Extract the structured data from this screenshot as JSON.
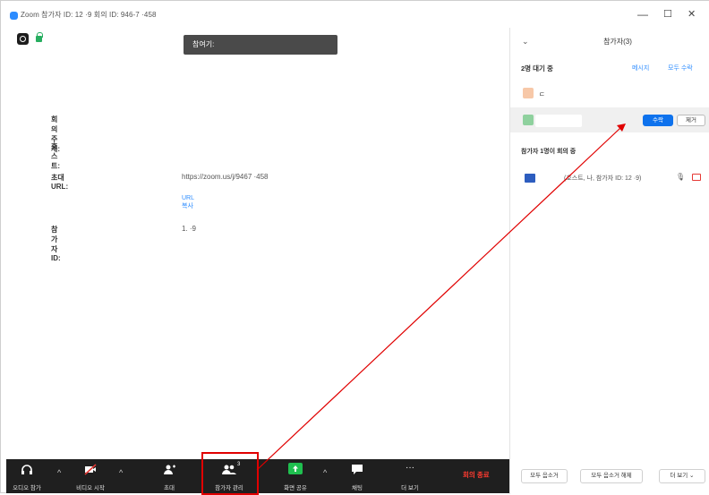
{
  "window": {
    "title": "Zoom 참가자 ID: 12 ·9 회의 ID: 946-7 ·458",
    "controls": {
      "minimize": "—",
      "maximize": "☐",
      "close": "✕"
    }
  },
  "main": {
    "tooltip": "참여기:",
    "info": {
      "topic_label": "회의 주제:",
      "host_label": "호스트:",
      "invite_url_label": "초대 URL:",
      "invite_url_value": "https://zoom.us/j/9467 ·458",
      "copy_url_link": "URL 복사",
      "participant_id_label": "참가자 ID:",
      "participant_id_value": "1. ·9"
    }
  },
  "toolbar": {
    "audio_label": "오디오 참가",
    "video_label": "비디오 시작",
    "invite_label": "초대",
    "participants_label": "참가자 관리",
    "participants_count": "3",
    "share_label": "화면 공유",
    "chat_label": "채팅",
    "more_label": "더 보기",
    "more_glyph": "···",
    "end_label": "회의 종료",
    "caret": "^"
  },
  "panel": {
    "collapse_glyph": "⌄",
    "title": "참가자(3)",
    "waiting_title": "2명 대기 중",
    "message_all": "메시지",
    "admit_all": "모두 수락",
    "waiting_1_name": "ㄷ",
    "admit_button": "수락",
    "remove_button": "제거",
    "in_meeting_title": "참가자 1명이 회의 중",
    "participant_1": "(호스트, 나, 참가자 ID: 12 ·9)",
    "mute_all": "모두 음소거",
    "unmute_all": "모두 음소거 해제",
    "more_button": "더 보기 ⌄"
  },
  "colors": {
    "accent_blue": "#0e72ed",
    "toolbar_bg": "#1f1f1f",
    "end_red": "#ff3b30",
    "annotation_red": "#e00000",
    "share_green": "#1fbf4f"
  }
}
